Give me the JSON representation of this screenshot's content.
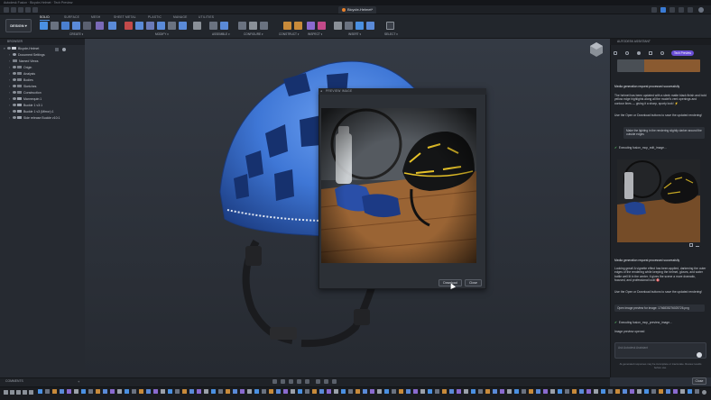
{
  "titlebar": {
    "text": "Autodesk Fusion · Bicycle-Helmet · Tech Preview"
  },
  "document_tab": {
    "title": "Bicycle-Helmet*"
  },
  "ribbon": {
    "workspace_button": "DESIGN ▾",
    "tabs": [
      "SOLID",
      "SURFACE",
      "MESH",
      "SHEET METAL",
      "PLASTIC",
      "MANAGE",
      "UTILITIES"
    ],
    "active_tab": "SOLID",
    "groups": [
      "CREATE ▾",
      "MODIFY ▾",
      "ASSEMBLE ▾",
      "CONFIGURE ▾",
      "CONSTRUCT ▾",
      "INSPECT ▾",
      "INSERT ▾",
      "SELECT ▾"
    ]
  },
  "browser": {
    "title": "BROWSER",
    "root": "Bicycle-Helmet",
    "items": [
      "Document Settings",
      "Named Views",
      "Origin",
      "Analysis",
      "Bodies",
      "Sketches",
      "Construction",
      "Mannequin:1",
      "Buckle 1 v3:1",
      "Buckle 1 v3 (Mirror):1",
      "Side release Buckle v10:1"
    ]
  },
  "dialog": {
    "title": "PREVIEW IMAGE",
    "download_label": "Download",
    "close_label": "Close"
  },
  "assistant": {
    "title": "AUTODESK ASSISTANT",
    "badge": "Tech Preview",
    "msg1_head": "Media generation request processed successfully",
    "msg1_body": "The helmet has been updated with a sleek matte black finish and bold yellow edge highlights along all the model's vent openings and contour lines — giving it a sharp, sporty look! ⚡",
    "msg1_hint": "Use the Open or Download buttons to save the updated rendering!",
    "user_msg": "Make the lighting in the rendering slightly darker around the outside edges",
    "exec1": "Executing fusion_mcp_edit_image...",
    "msg2_head": "Media generation request processed successfully",
    "msg2_body": "Looking great! A vignette effect has been applied, darkening the outer edges of the rendering while keeping the helmet, gloves, and water bottle well lit in the center. It gives the scene a more dramatic, focused, and professional look! 🎯",
    "msg2_hint": "Use the Open or Download buttons to save the updated rendering!",
    "preview_box": "Open image preview for image: 1746835276025726.png",
    "exec2": "Executing fusion_mcp_preview_image...",
    "status": "Image preview opened",
    "input_placeholder": "Ask Autodesk Assistant",
    "disclaimer": "AI-generated responses may be incomplete or inaccurate. Review results before use.",
    "close_label": "Close"
  },
  "comments": {
    "label": "COMMENTS"
  },
  "colors": {
    "accent": "#4a90e2",
    "helmet_blue": "#3f77d6",
    "success": "#5fc46b",
    "badge_purple": "#6a4fd6"
  }
}
